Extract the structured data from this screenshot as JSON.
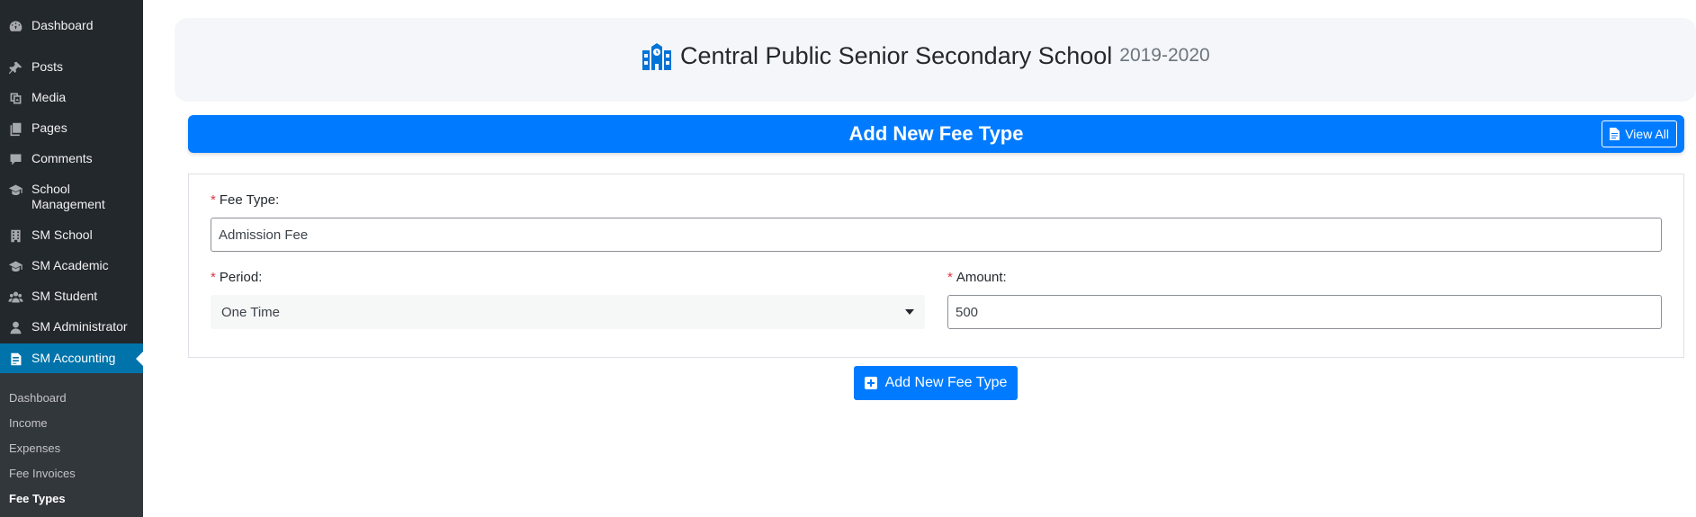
{
  "sidebar": {
    "items": [
      {
        "label": "Dashboard",
        "icon": "dashboard-icon"
      },
      {
        "label": "Posts",
        "icon": "pin-icon"
      },
      {
        "label": "Media",
        "icon": "media-icon"
      },
      {
        "label": "Pages",
        "icon": "pages-icon"
      },
      {
        "label": "Comments",
        "icon": "comments-icon"
      },
      {
        "label": "School Management",
        "icon": "graduation-cap-icon"
      },
      {
        "label": "SM School",
        "icon": "building-icon"
      },
      {
        "label": "SM Academic",
        "icon": "graduation-cap-icon"
      },
      {
        "label": "SM Student",
        "icon": "users-icon"
      },
      {
        "label": "SM Administrator",
        "icon": "user-icon"
      },
      {
        "label": "SM Accounting",
        "icon": "document-icon",
        "active": true
      }
    ],
    "submenu": [
      {
        "label": "Dashboard"
      },
      {
        "label": "Income"
      },
      {
        "label": "Expenses"
      },
      {
        "label": "Fee Invoices"
      },
      {
        "label": "Fee Types",
        "current": true
      }
    ]
  },
  "header": {
    "school_name": "Central Public Senior Secondary School",
    "session": "2019-2020",
    "icon": "school-icon"
  },
  "form_bar": {
    "title": "Add New Fee Type",
    "view_all_label": "View All"
  },
  "form": {
    "fee_type": {
      "required_mark": "*",
      "label": "Fee Type:",
      "value": "Admission Fee"
    },
    "period": {
      "required_mark": "*",
      "label": "Period:",
      "value": "One Time"
    },
    "amount": {
      "required_mark": "*",
      "label": "Amount:",
      "value": "500"
    },
    "submit_label": "Add New Fee Type"
  },
  "colors": {
    "sidebar_bg": "#23282d",
    "submenu_bg": "#32373c",
    "active_menu": "#0073aa",
    "primary": "#007bff",
    "required": "#dc3545"
  }
}
